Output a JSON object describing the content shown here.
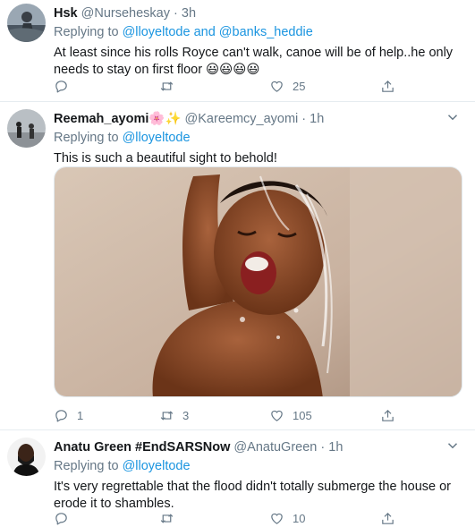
{
  "tweets": [
    {
      "name": "Hsk",
      "handle": "@Nurseheskay",
      "separator": "·",
      "time": "3h",
      "replying_prefix": "Replying to",
      "replying_to": "@lloyeltode and @banks_heddie",
      "text": "At least since his rolls Royce can't walk, canoe will be of help..he only needs to stay on first floor 😃😃😃😃",
      "replies": "",
      "retweets": "",
      "likes": "25"
    },
    {
      "name": "Reemah_ayomi🌸✨",
      "handle": "@Kareemcy_ayomi",
      "separator": "·",
      "time": "1h",
      "replying_prefix": "Replying to",
      "replying_to": "@lloyeltode",
      "text": "This is such a beautiful sight to behold!",
      "replies": "1",
      "retweets": "3",
      "likes": "105"
    },
    {
      "name": "Anatu Green #EndSARSNow",
      "handle": "@AnatuGreen",
      "separator": "·",
      "time": "1h",
      "replying_prefix": "Replying to",
      "replying_to": "@lloyeltode",
      "text": "It's very regrettable that the flood didn't totally submerge the house or erode it to shambles.",
      "replies": "",
      "retweets": "",
      "likes": "10"
    }
  ],
  "icons": {
    "reply": "reply-icon",
    "retweet": "retweet-icon",
    "like": "heart-icon",
    "share": "share-icon",
    "more": "chevron-down-icon"
  },
  "colors": {
    "link": "#1b95e0",
    "secondary_text": "#657786",
    "divider": "#e6ecf0"
  }
}
